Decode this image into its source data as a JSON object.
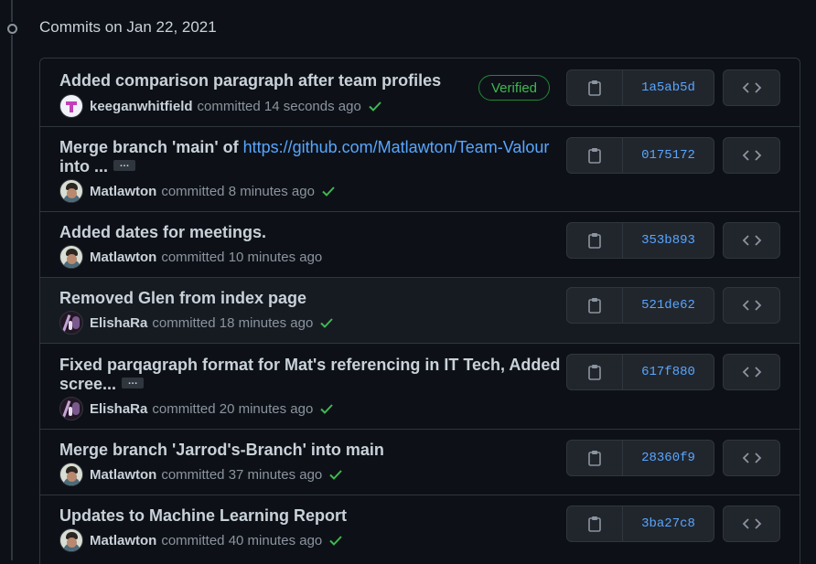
{
  "section": {
    "title": "Commits on Jan 22, 2021"
  },
  "commits": [
    {
      "message": "Added comparison paragraph after team profiles",
      "author": "keeganwhitfield",
      "time": "committed 14 seconds ago",
      "status": "success",
      "verified_label": "Verified",
      "sha": "1a5ab5d",
      "avatar": "keegan"
    },
    {
      "message": "Merge branch 'main' of ",
      "link": "https://github.com/Matlawton/Team-Valour",
      "message_line2": "into ...",
      "ellipsis": "…",
      "author": "Matlawton",
      "time": "committed 8 minutes ago",
      "status": "success",
      "sha": "0175172",
      "avatar": "mat"
    },
    {
      "message": "Added dates for meetings.",
      "author": "Matlawton",
      "time": "committed 10 minutes ago",
      "status": "none",
      "sha": "353b893",
      "avatar": "mat"
    },
    {
      "message": "Removed Glen from index page",
      "author": "ElishaRa",
      "time": "committed 18 minutes ago",
      "status": "success",
      "sha": "521de62",
      "avatar": "elisha"
    },
    {
      "message": "Fixed parqagraph format for Mat's referencing in IT Tech, Added",
      "message_line2": "scree...",
      "ellipsis": "…",
      "author": "ElishaRa",
      "time": "committed 20 minutes ago",
      "status": "success",
      "sha": "617f880",
      "avatar": "elisha"
    },
    {
      "message": "Merge branch 'Jarrod's-Branch' into main",
      "author": "Matlawton",
      "time": "committed 37 minutes ago",
      "status": "success",
      "sha": "28360f9",
      "avatar": "mat"
    },
    {
      "message": "Updates to Machine Learning Report",
      "author": "Matlawton",
      "time": "committed 40 minutes ago",
      "status": "success",
      "sha": "3ba27c8",
      "avatar": "mat"
    }
  ],
  "icons": {
    "copy": "clipboard-icon",
    "browse": "code-icon",
    "status": "check-icon",
    "timeline": "git-commit-icon"
  },
  "colors": {
    "background": "#0d1117",
    "border": "#30363d",
    "link": "#58a6ff",
    "success": "#3fb950"
  }
}
